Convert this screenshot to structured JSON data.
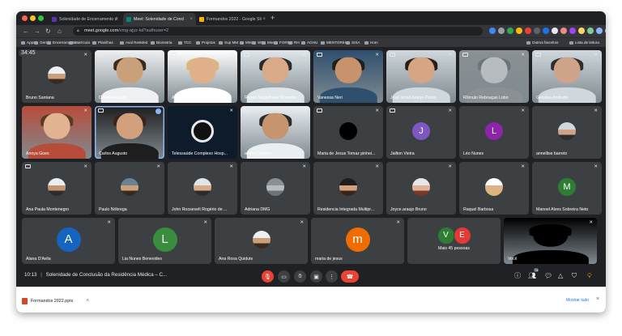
{
  "browser": {
    "tabs": [
      {
        "label": "Solenidade de Encerramento d",
        "active": false,
        "favicon_color": "#5e35b1"
      },
      {
        "label": "Meet: Solenidade de Concl",
        "active": true,
        "favicon_color": "#00897b"
      },
      {
        "label": "Formandos 2022 - Google Sli",
        "active": false,
        "favicon_color": "#f4b400"
      }
    ],
    "close_glyph": "×",
    "newtab_glyph": "+",
    "url": "meet.google.com",
    "url_path": "/vmg-ajyz-kd?authuser=2",
    "bookmarks": [
      "Apps",
      "Geral",
      "Encerramento",
      "Matrícula",
      "Planilhas",
      "Aval ResMed",
      "Biometria",
      "TCC",
      "Projetos",
      "Sup MM",
      "MM",
      "WP",
      "Meet",
      "FORMS",
      "RH",
      "AGHU",
      "MENTORIH...",
      "SISA",
      "Hom"
    ],
    "other_bookmarks": "Outros favoritos",
    "reading_list": "Lista de leitura"
  },
  "meeting": {
    "clock": "34:45",
    "participants": [
      {
        "name": "Bruno Santana",
        "type": "avatar",
        "mic_muted": true
      },
      {
        "name": "Daniella Castro",
        "type": "video",
        "mic_muted": true,
        "screen_icon": true
      },
      {
        "name": "Andrea Nogueira",
        "type": "video",
        "mic_muted": true,
        "screen_icon": true
      },
      {
        "name": "Renan Magalhaes Montene...",
        "type": "video",
        "mic_muted": true,
        "screen_icon": true
      },
      {
        "name": "Vanessa Neri",
        "type": "video",
        "mic_muted": true,
        "screen_icon": true
      },
      {
        "name": "José Israel Araújo Ponte",
        "type": "video",
        "mic_muted": true,
        "screen_icon": true
      },
      {
        "name": "Rômulo Rebouças Lobo",
        "type": "video",
        "mic_muted": true,
        "screen_icon": true
      },
      {
        "name": "Gessika Andrade",
        "type": "video",
        "mic_muted": true,
        "screen_icon": true
      },
      {
        "name": "Annya Goes",
        "type": "video",
        "mic_muted": true
      },
      {
        "name": "Carlos Augusto",
        "type": "video",
        "mic_muted": false,
        "speaking": true,
        "screen_icon": true
      },
      {
        "name": "Telessaúde Complexo Hosp...",
        "type": "logo",
        "mic_muted": true
      },
      {
        "name": "airtes Caroline",
        "type": "video",
        "mic_muted": true,
        "screen_icon": true
      },
      {
        "name": "Maria de Jesus Tomaz pinhei...",
        "type": "avatar",
        "mic_muted": true,
        "screen_icon": true
      },
      {
        "name": "Jailton Vieira",
        "type": "letter",
        "letter": "J",
        "color": "#7e57c2",
        "mic_muted": true,
        "screen_icon": true
      },
      {
        "name": "Léo Nunes",
        "type": "letter",
        "letter": "L",
        "color": "#8e24aa",
        "mic_muted": true
      },
      {
        "name": "annellise barreto",
        "type": "avatar",
        "mic_muted": true
      },
      {
        "name": "Ana Paula Montenegro",
        "type": "avatar",
        "mic_muted": true,
        "screen_icon": true
      },
      {
        "name": "Paulo Nóbrega",
        "type": "avatar",
        "mic_muted": true
      },
      {
        "name": "John Roosevelt Rogério de ...",
        "type": "avatar",
        "mic_muted": true
      },
      {
        "name": "Adriana DMG",
        "type": "avatar",
        "mic_muted": true
      },
      {
        "name": "Residencia Integrada Multipr...",
        "type": "avatar",
        "mic_muted": true
      },
      {
        "name": "Joyce.araujo Bruno",
        "type": "avatar",
        "mic_muted": true
      },
      {
        "name": "Raquel Barbosa",
        "type": "avatar",
        "mic_muted": true
      },
      {
        "name": "Manoel Alves Sobreira Neto",
        "type": "letter",
        "letter": "M",
        "color": "#2e7d32",
        "mic_muted": true
      },
      {
        "name": "Alana D'Avila",
        "type": "letter",
        "letter": "A",
        "color": "#1565c0",
        "mic_muted": true
      },
      {
        "name": "Lia Nunes Benevides",
        "type": "letter",
        "letter": "L",
        "color": "#388e3c",
        "mic_muted": true
      },
      {
        "name": "Ana Rosa Quidute",
        "type": "avatar",
        "mic_muted": true
      },
      {
        "name": "maria de jesus",
        "type": "letter",
        "letter": "m",
        "color": "#ef6c00",
        "mic_muted": true
      },
      {
        "name": "Mais 45 pessoas",
        "type": "more",
        "letters": [
          "V",
          "E"
        ],
        "colors": [
          "#2e7d32",
          "#e53935"
        ]
      },
      {
        "name": "Você",
        "type": "video",
        "mic_muted": true
      }
    ],
    "mic_glyph": "✕",
    "bottom": {
      "time": "10:13",
      "separator": "|",
      "title": "Solenidade de Conclusão da Residência Médica – C...",
      "controls": [
        "mic-off",
        "camera",
        "hand",
        "present",
        "more-options"
      ],
      "end_call_glyph": "☎",
      "participant_count": "74"
    }
  },
  "downloads": {
    "file": "Formandos 2022.pptx",
    "chevron": "˄",
    "show_all": "Mostrar tudo",
    "close": "×"
  }
}
